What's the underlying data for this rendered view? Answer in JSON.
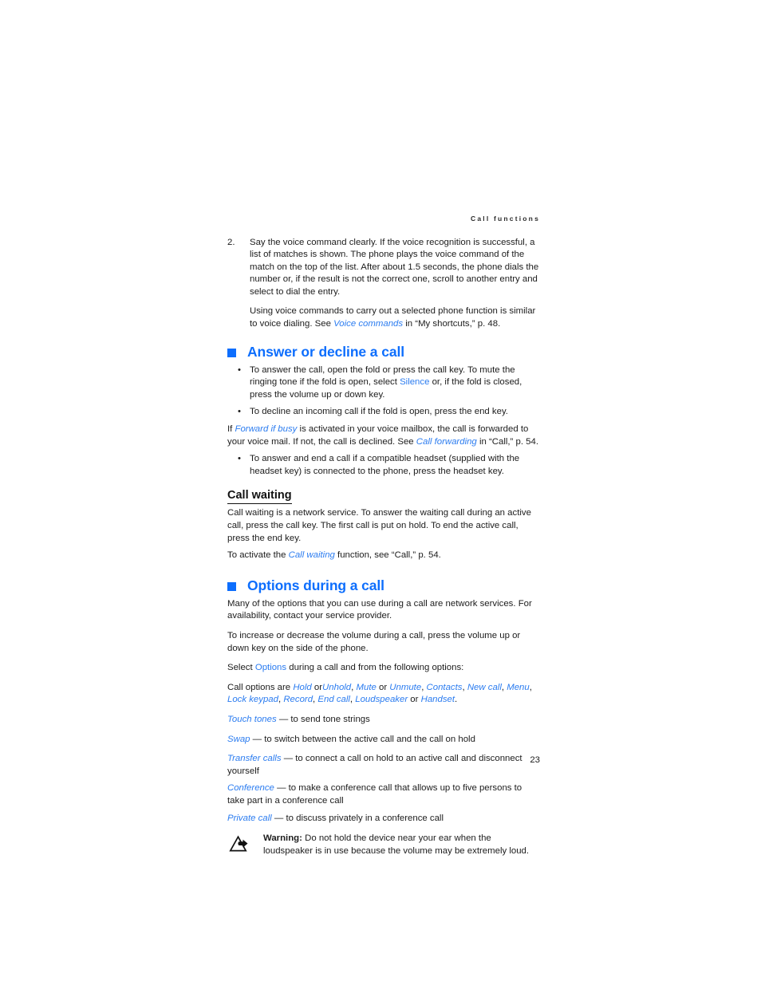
{
  "document": {
    "running_header": "Call functions",
    "page_number": "23",
    "accent_color": "#0d6efd",
    "link_color": "#2b7cf0",
    "text_color": "#1c1c1c"
  },
  "numbered_list": [
    {
      "number": "2.",
      "text": "Say the voice command clearly. If the voice recognition is successful, a list of matches is shown. The phone plays the voice command of the match on the top of the list. After about 1.5 seconds, the phone dials the number or, if the result is not the correct one, scroll to another entry and select to dial the entry."
    }
  ],
  "voice_commands_para": {
    "lead": "Using voice commands to carry out a selected phone function is similar to voice dialing. See ",
    "link": "Voice commands",
    "tail": " in “My shortcuts,” p. 48."
  },
  "section_answer": {
    "heading": "Answer or decline a call",
    "square_icon": "blue-square-bullet-icon",
    "bullets": [
      {
        "marker": "•",
        "lead": "To answer the call, open the fold or press the call key. To mute the ringing tone if the fold is open, select ",
        "link": "Silence",
        "tail": " or, if the fold is closed, press the volume up or down key."
      },
      {
        "marker": "•",
        "lead": "To decline an incoming call if the fold is open, press the end key.",
        "link": "",
        "tail": ""
      }
    ],
    "forward_para": {
      "lead": "If ",
      "link1": "Forward if busy",
      "mid": " is activated in your voice mailbox, the call is forwarded to your voice mail. If not, the call is declined. See ",
      "link2": "Call forwarding",
      "tail": " in “Call,” p. 54."
    },
    "headset_bullet": {
      "marker": "•",
      "text": "To answer and end a call if a compatible headset (supplied with the headset key) is connected to the phone, press the headset key."
    },
    "subsection": {
      "heading": "Call waiting",
      "para1": "Call waiting is a network service. To answer the waiting call during an active call, press the call key. The first call is put on hold. To end the active call, press the end key.",
      "para2": {
        "lead": "To activate the ",
        "link": "Call waiting",
        "tail": " function, see “Call,” p. 54."
      }
    }
  },
  "section_options": {
    "heading": "Options during a call",
    "square_icon": "blue-square-bullet-icon",
    "para1": "Many of the options that you can use during a call are network services. For availability, contact your service provider.",
    "para2": "To increase or decrease the volume during a call, press the volume up or down key on the side of the phone.",
    "para3": {
      "lead": "Select ",
      "link": "Options",
      "tail": " during a call and from the following options:"
    },
    "call_options_para": {
      "lead": "Call options are ",
      "items": [
        "Hold",
        "Unhold",
        "Mute",
        "Unmute",
        "Contacts",
        "New call",
        "Menu",
        "Lock keypad",
        "Record",
        "End call",
        "Loudspeaker",
        "Handset"
      ]
    },
    "definitions": [
      {
        "term": "Touch tones",
        "dash": "—",
        "desc": "to send tone strings"
      },
      {
        "term": "Swap",
        "dash": "—",
        "desc": "to switch between the active call and the call on hold"
      },
      {
        "term": "Transfer calls",
        "dash": "—",
        "desc": "to connect a call on hold to an active call and disconnect yourself"
      },
      {
        "term": "Conference",
        "dash": "—",
        "desc": "to make a conference call that allows up to five persons to take part in a conference call"
      },
      {
        "term": "Private call",
        "dash": "—",
        "desc": "to discuss privately in a conference call"
      }
    ],
    "warning": {
      "icon": "warning-loudspeaker-triangle-icon",
      "label": "Warning:",
      "text": " Do not hold the device near your ear when the loudspeaker is in use because the volume may be extremely loud."
    }
  }
}
